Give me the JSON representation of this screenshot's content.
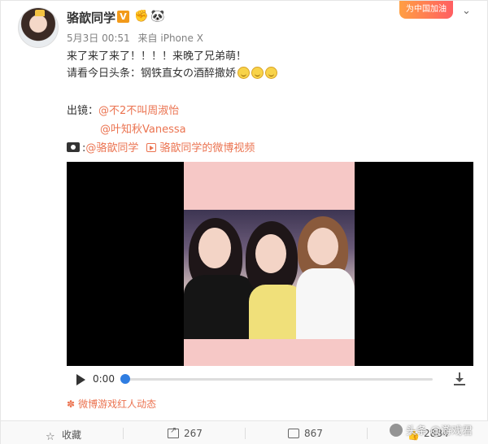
{
  "post": {
    "username": "骆歆同学",
    "v_badge": "V",
    "date": "5月3日",
    "time": "00:51",
    "source_prefix": "来自",
    "source": "iPhone X",
    "promo_label": "为中国加油",
    "line1": "来了来了来了！！！！来晚了兄弟萌！",
    "line2": "请看今日头条：钢铁直女の酒醉撒娇",
    "credits_label": "出镜：",
    "mention1": "@不2不叫周淑怡",
    "mention2": "@叶知秋Vanessa",
    "camera_mention": "@骆歆同学",
    "video_link": "骆歆同学的微博视频",
    "topic_tag": "微博游戏红人动态"
  },
  "video": {
    "current_time": "0:00",
    "progress": 0
  },
  "actions": {
    "favorite": "收藏",
    "share_count": "267",
    "comment_count": "867",
    "like_count": "2884"
  },
  "watermark": "头条 @游戏君",
  "colors": {
    "accent": "#eb7350",
    "text": "#333333",
    "meta": "#808080",
    "progress_knob": "#2f7de1"
  },
  "icons": [
    "avatar",
    "verified-badge",
    "hand-badge-icon",
    "panda-icon",
    "chevron-down-icon",
    "emoji-icon",
    "camera-icon",
    "video-link-icon",
    "play-icon",
    "download-icon",
    "flower-icon",
    "star-icon",
    "share-icon",
    "comment-icon",
    "like-icon"
  ]
}
